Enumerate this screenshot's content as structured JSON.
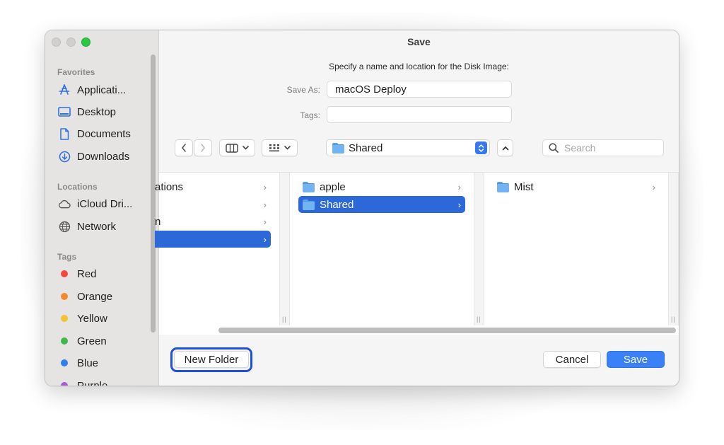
{
  "window": {
    "title": "Save"
  },
  "sidebar": {
    "favorites_heading": "Favorites",
    "favorites": [
      {
        "label": "Applicati...",
        "icon": "applications-icon"
      },
      {
        "label": "Desktop",
        "icon": "desktop-icon"
      },
      {
        "label": "Documents",
        "icon": "document-icon"
      },
      {
        "label": "Downloads",
        "icon": "downloads-icon"
      }
    ],
    "locations_heading": "Locations",
    "locations": [
      {
        "label": "iCloud Dri...",
        "icon": "cloud-icon"
      },
      {
        "label": "Network",
        "icon": "globe-icon"
      }
    ],
    "tags_heading": "Tags",
    "tags": [
      {
        "label": "Red",
        "color": "#f04a3e"
      },
      {
        "label": "Orange",
        "color": "#f28a2e"
      },
      {
        "label": "Yellow",
        "color": "#f2c230"
      },
      {
        "label": "Green",
        "color": "#3db94a"
      },
      {
        "label": "Blue",
        "color": "#2f7ef0"
      },
      {
        "label": "Purple",
        "color": "#a65ad2"
      }
    ]
  },
  "dialog": {
    "prompt": "Specify a name and location for the Disk Image:",
    "save_as_label": "Save As:",
    "save_as_value": "macOS Deploy",
    "tags_label": "Tags:",
    "tags_value": ""
  },
  "toolbar": {
    "location": "Shared",
    "search_placeholder": "Search"
  },
  "browser": {
    "col1": [
      {
        "label": "ations"
      },
      {
        "label": ""
      },
      {
        "label": "n"
      },
      {
        "label": ""
      }
    ],
    "col2": [
      {
        "label": "apple"
      },
      {
        "label": "Shared"
      }
    ],
    "col3": [
      {
        "label": "Mist"
      }
    ]
  },
  "buttons": {
    "new_folder": "New Folder",
    "cancel": "Cancel",
    "save": "Save"
  },
  "colors": {
    "accent": "#3a80f6",
    "selection": "#2c68d8",
    "focus_ring": "#1f4fe0"
  }
}
